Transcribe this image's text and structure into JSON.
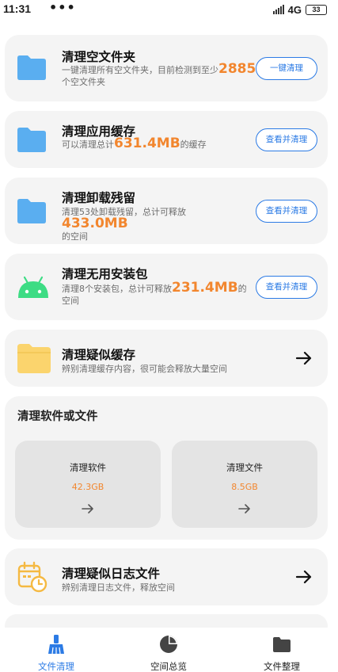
{
  "status_bar": {
    "time": "11:31",
    "dots": "•••",
    "network": "4G",
    "battery": "33"
  },
  "cards": [
    {
      "title": "清理空文件夹",
      "desc_prefix": "一键清理所有空文件夹，目前检测到至少",
      "highlight": "2885",
      "desc_suffix": "个空文件夹",
      "button": "一键清理",
      "icon": "folder-icon"
    },
    {
      "title": "清理应用缓存",
      "desc_prefix": "可以清理总计",
      "highlight": "631.4MB",
      "desc_suffix": "的缓存",
      "button": "查看并清理",
      "icon": "folder-icon"
    },
    {
      "title": "清理卸载残留",
      "desc_prefix": "清理53处卸载残留，总计可释放",
      "highlight": "433.0MB",
      "desc_suffix": "的空间",
      "button": "查看并清理",
      "icon": "folder-icon"
    },
    {
      "title": "清理无用安装包",
      "desc_prefix": "清理8个安装包，总计可释放",
      "highlight": "231.4MB",
      "desc_suffix": "的空间",
      "button": "查看并清理",
      "icon": "android-icon"
    },
    {
      "title": "清理疑似缓存",
      "desc": "辨别清理缓存内容，很可能会释放大量空间",
      "icon": "yellow-folder-icon"
    }
  ],
  "software_section": {
    "title": "清理软件或文件",
    "tiles": [
      {
        "name": "清理软件",
        "size": "42.3GB"
      },
      {
        "name": "清理文件",
        "size": "8.5GB"
      }
    ]
  },
  "log_card": {
    "title": "清理疑似日志文件",
    "desc": "辨别清理日志文件，释放空间",
    "icon": "calendar-clock-icon"
  },
  "bottom_nav": [
    {
      "label": "文件清理",
      "icon": "broom-icon",
      "active": true
    },
    {
      "label": "空间总览",
      "icon": "pie-chart-icon",
      "active": false
    },
    {
      "label": "文件整理",
      "icon": "folder-icon",
      "active": false
    }
  ],
  "colors": {
    "accent": "#2c7be5",
    "highlight": "#f2862e",
    "folder_blue": "#5aaef0",
    "android_green": "#3ddc84",
    "folder_yellow": "#fbd46d"
  }
}
